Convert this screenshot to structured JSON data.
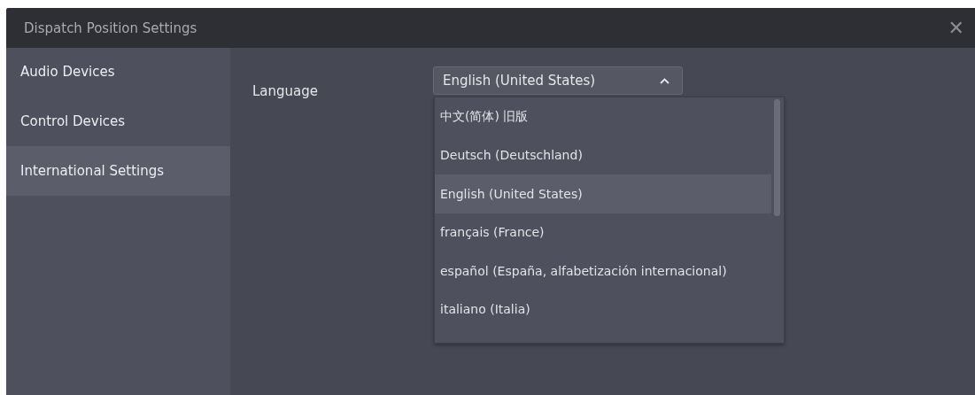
{
  "window": {
    "title": "Dispatch Position Settings",
    "close_glyph": "✕"
  },
  "sidebar": {
    "items": [
      {
        "label": "Audio Devices",
        "selected": false
      },
      {
        "label": "Control Devices",
        "selected": false
      },
      {
        "label": "International Settings",
        "selected": true
      }
    ]
  },
  "language": {
    "label": "Language",
    "value": "English (United States)",
    "expanded": true,
    "options": [
      {
        "label": "中文(简体) 旧版",
        "selected": false
      },
      {
        "label": "Deutsch (Deutschland)",
        "selected": false
      },
      {
        "label": "English (United States)",
        "selected": true
      },
      {
        "label": "français (France)",
        "selected": false
      },
      {
        "label": "español (España, alfabetización internacional)",
        "selected": false
      },
      {
        "label": "italiano (Italia)",
        "selected": false
      }
    ]
  }
}
